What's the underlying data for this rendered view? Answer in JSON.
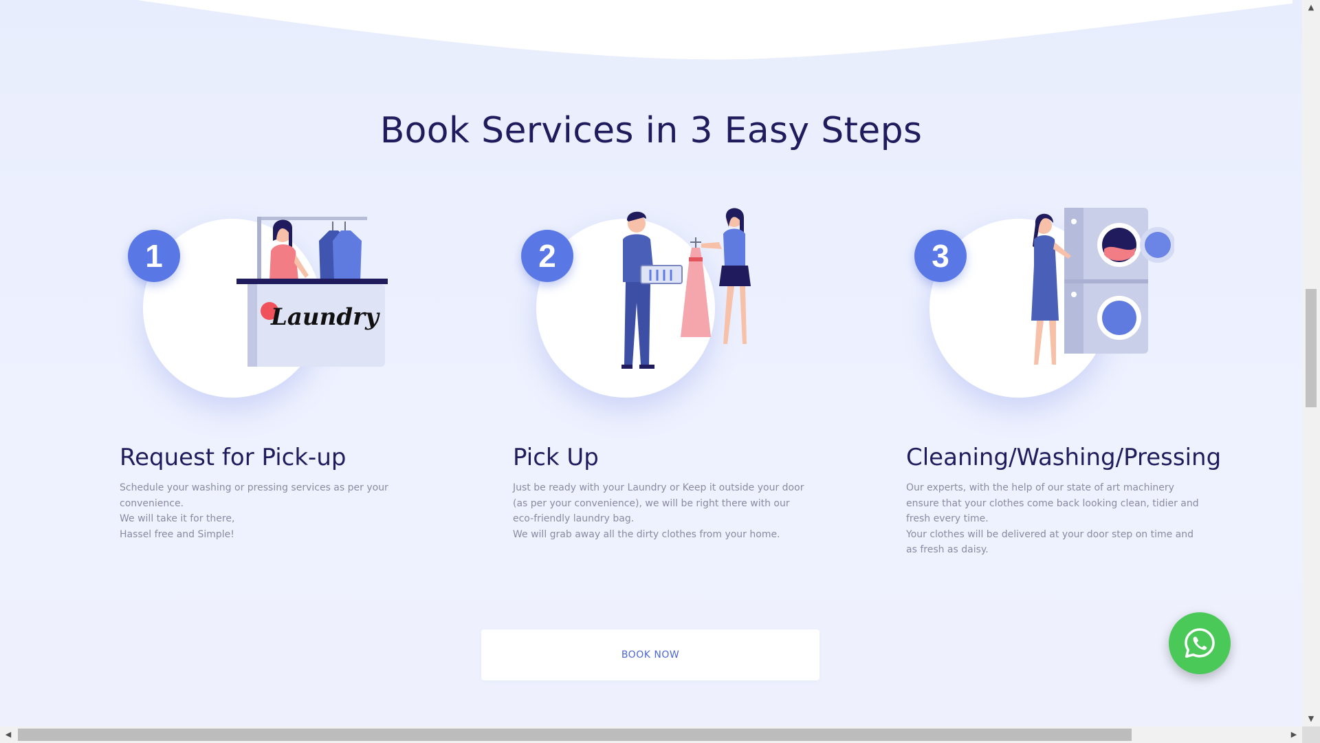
{
  "section": {
    "title": "Book Services in 3 Easy Steps"
  },
  "steps": [
    {
      "number": "1",
      "title": "Request for Pick-up",
      "illustration_label": "Laundry",
      "lines": [
        "Schedule your washing or pressing services as per your convenience.",
        "We will take it for there,",
        "Hassel free and Simple!"
      ]
    },
    {
      "number": "2",
      "title": "Pick Up",
      "lines": [
        "Just be ready with your Laundry or Keep it outside your door (as per your convenience), we will be right there with our eco-friendly laundry bag.",
        "We will grab away all the dirty clothes from your home."
      ]
    },
    {
      "number": "3",
      "title": "Cleaning/Washing/Pressing",
      "lines": [
        "Our experts, with the help of our state of art machinery ensure that your clothes come back looking clean, tidier and fresh every time.",
        "Your clothes will be delivered at your door step on time and as fresh as daisy."
      ]
    }
  ],
  "cta": {
    "label": "BOOK NOW"
  },
  "floating": {
    "icon": "whatsapp-icon",
    "color": "#4ac959"
  },
  "colors": {
    "heading": "#1f1b5c",
    "accent": "#5a78e5",
    "body_text": "#8a8ba3",
    "background": "#ebeffd"
  }
}
